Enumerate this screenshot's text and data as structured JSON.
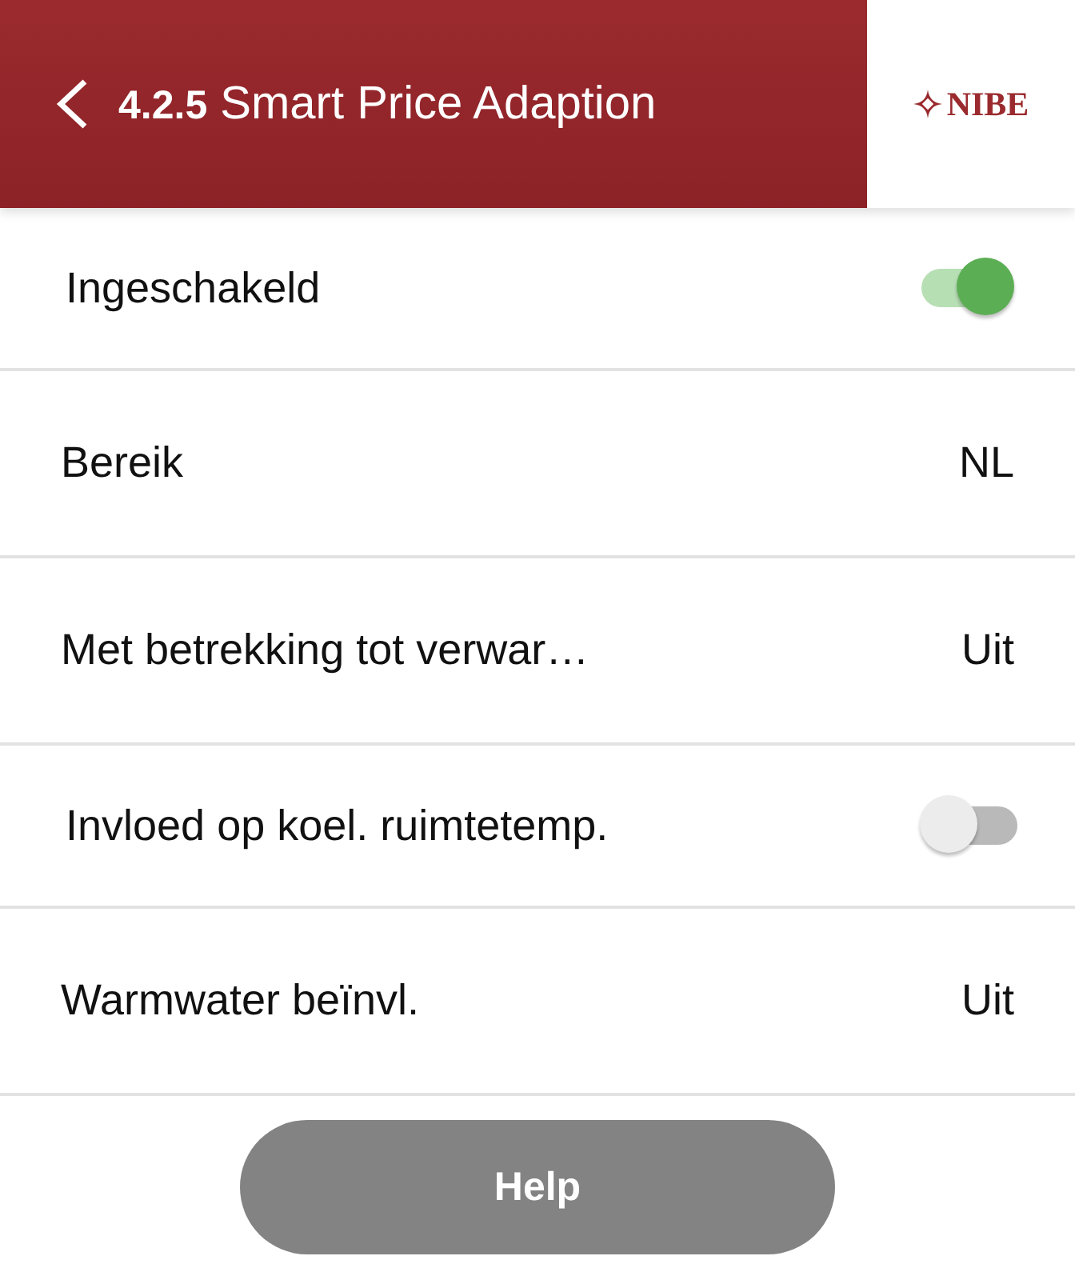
{
  "header": {
    "title": "**4.2.5** Smart Price Adaption",
    "logo": "NIBE"
  },
  "settings": [
    {
      "kind": "toggle",
      "label": "Ingeschakeld",
      "on": true
    },
    {
      "kind": "value",
      "label": "Bereik",
      "value": "NL"
    },
    {
      "kind": "value",
      "label": "Met betrekking tot verwar…",
      "value": "Uit"
    },
    {
      "kind": "toggle",
      "label": "Invloed op koel. ruimtetemp.",
      "on": false
    },
    {
      "kind": "value",
      "label": "Warmwater beïnvl.",
      "value": "Uit"
    }
  ],
  "help_button": "Help"
}
